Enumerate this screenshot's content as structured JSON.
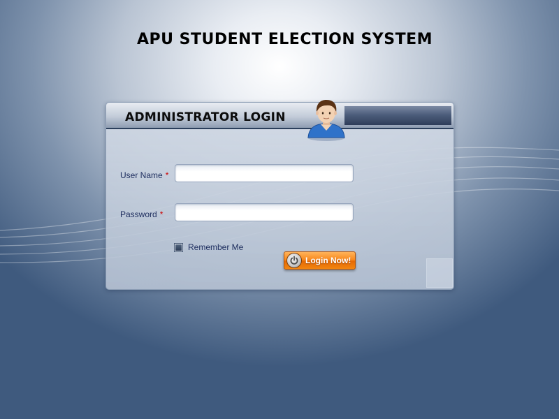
{
  "page": {
    "title": "APU STUDENT ELECTION SYSTEM"
  },
  "login_panel": {
    "title": "ADMINISTRATOR LOGIN",
    "username_label": "User Name",
    "password_label": "Password",
    "required_marker": "*",
    "username_value": "",
    "password_value": "",
    "remember_label": "Remember Me",
    "remember_checked": false,
    "login_button_label": "Login Now!"
  },
  "icons": {
    "avatar": "user-avatar-icon",
    "login": "power-icon"
  },
  "colors": {
    "button_orange": "#f98a1f",
    "label_navy": "#1d2d5e",
    "required_red": "#cc0000"
  }
}
